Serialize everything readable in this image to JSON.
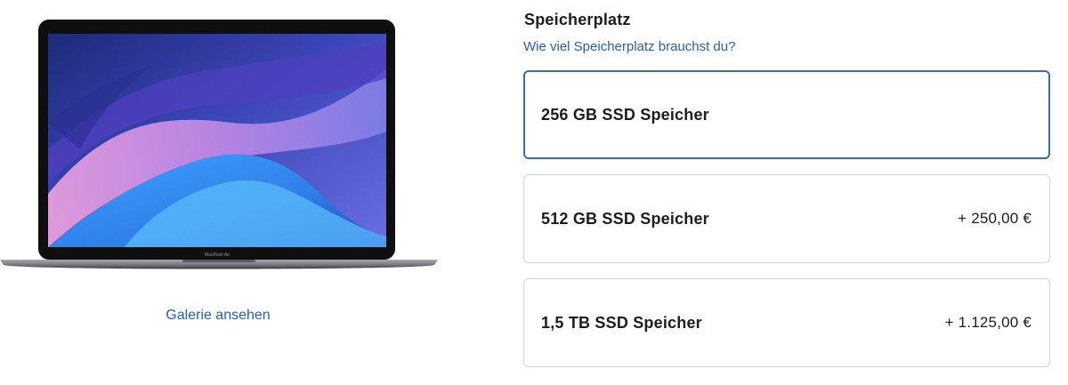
{
  "product": {
    "screen_brand_text": "MacBook Air",
    "gallery_link": "Galerie ansehen"
  },
  "storage": {
    "title": "Speicherplatz",
    "help_link": "Wie viel Speicherplatz brauchst du?",
    "options": [
      {
        "label": "256 GB SSD Speicher",
        "price": "",
        "selected": true
      },
      {
        "label": "512 GB SSD Speicher",
        "price": "+ 250,00 €",
        "selected": false
      },
      {
        "label": "1,5 TB SSD Speicher",
        "price": "+ 1.125,00 €",
        "selected": false
      }
    ]
  },
  "colors": {
    "link": "#2a5fa8",
    "selected_border": "#3a6cb2",
    "border": "#d2d2d7",
    "text": "#1d1d1f"
  }
}
